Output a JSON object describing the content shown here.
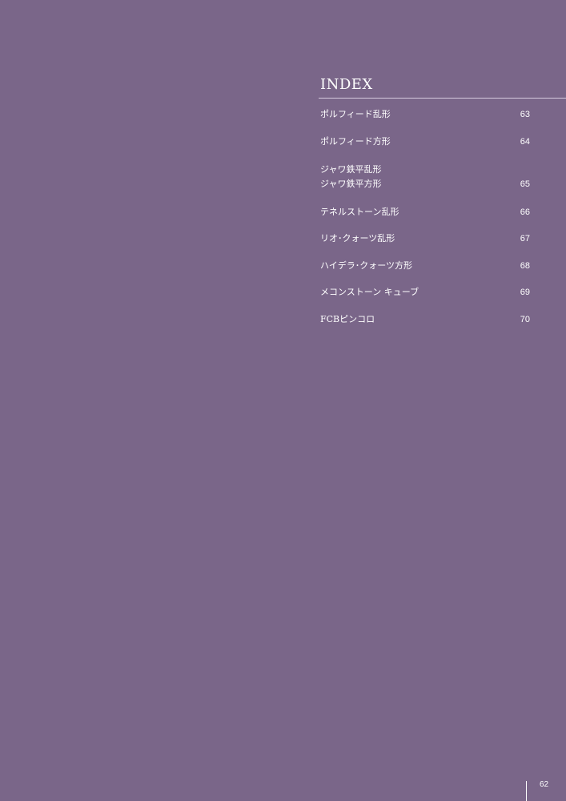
{
  "index": {
    "title": "INDEX",
    "entries": [
      {
        "name": "ポルフィード乱形",
        "page": "63"
      },
      {
        "name": "ポルフィード方形",
        "page": "64"
      },
      {
        "name_line1": "ジャワ鉄平乱形",
        "name": "ジャワ鉄平方形",
        "page": "65"
      },
      {
        "name": "テネルストーン乱形",
        "page": "66"
      },
      {
        "name": "リオ･クォーツ乱形",
        "page": "67"
      },
      {
        "name": "ハイデラ･クォーツ方形",
        "page": "68"
      },
      {
        "name": "メコンストーン キューブ",
        "page": "69"
      },
      {
        "name": "FCBピンコロ",
        "page": "70"
      }
    ]
  },
  "footer": {
    "page_number": "62"
  },
  "colors": {
    "background": "#7a6689",
    "text": "#ffffff"
  }
}
